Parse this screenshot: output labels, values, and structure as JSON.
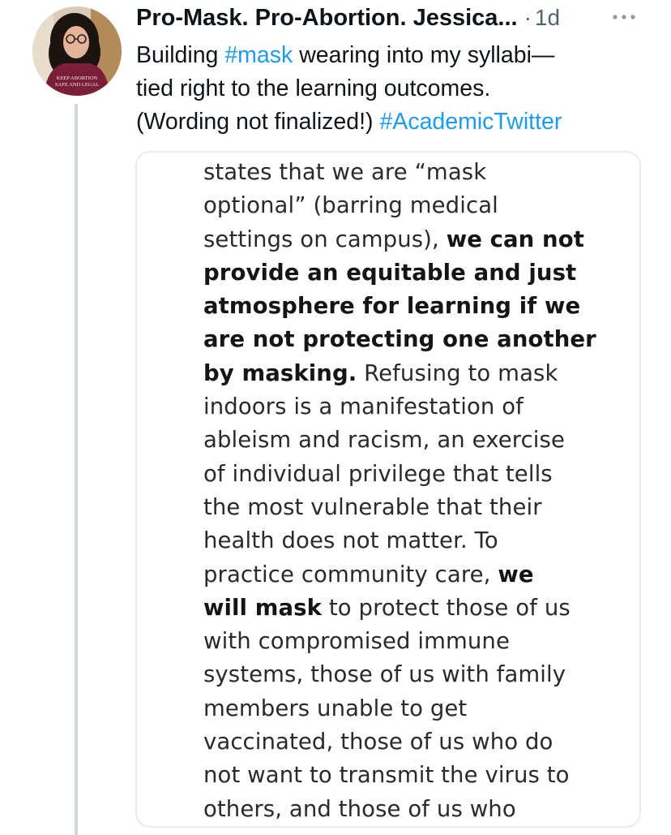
{
  "tweet": {
    "display_name": "Pro-Mask. Pro-Abortion. Jessica...",
    "dot": "·",
    "timestamp": "1d",
    "more_label": "···",
    "text": {
      "part1": "Building ",
      "hashtag1": "#mask",
      "part2": " wearing into my syllabi—",
      "part3": "tied right to the learning outcomes.",
      "part4": "(Wording not finalized!) ",
      "hashtag2": "#AcademicTwitter"
    },
    "avatar": {
      "shirt_text_line1": "KEEP ABORTION",
      "shirt_text_line2": "SAFE AND LEGAL"
    }
  },
  "media": {
    "lines": [
      {
        "t1": "states that we are “mask",
        "b": "",
        "t2": ""
      },
      {
        "t1": "optional” (barring medical",
        "b": "",
        "t2": ""
      },
      {
        "t1": "settings on campus), ",
        "b": "we can not",
        "t2": ""
      },
      {
        "t1": "",
        "b": "provide an equitable and just",
        "t2": ""
      },
      {
        "t1": "",
        "b": "atmosphere for learning if we",
        "t2": ""
      },
      {
        "t1": "",
        "b": "are not protecting one another",
        "t2": ""
      },
      {
        "t1": "",
        "b": "by masking.",
        "t2": " Refusing to mask"
      },
      {
        "t1": "indoors is a manifestation of",
        "b": "",
        "t2": ""
      },
      {
        "t1": "ableism and racism, an exercise",
        "b": "",
        "t2": ""
      },
      {
        "t1": "of individual privilege that tells",
        "b": "",
        "t2": ""
      },
      {
        "t1": "the most vulnerable that their",
        "b": "",
        "t2": ""
      },
      {
        "t1": "health does not matter. To",
        "b": "",
        "t2": ""
      },
      {
        "t1": "practice community care, ",
        "b": "we",
        "t2": ""
      },
      {
        "t1": "",
        "b": "will mask",
        "t2": " to protect those of us"
      },
      {
        "t1": "with compromised immune",
        "b": "",
        "t2": ""
      },
      {
        "t1": "systems, those of us with family",
        "b": "",
        "t2": ""
      },
      {
        "t1": "members unable to get",
        "b": "",
        "t2": ""
      },
      {
        "t1": "vaccinated, those of us who do",
        "b": "",
        "t2": ""
      },
      {
        "t1": "not want to transmit the virus to",
        "b": "",
        "t2": ""
      },
      {
        "t1": "others, and those of us who",
        "b": "",
        "t2": ""
      }
    ]
  },
  "colors": {
    "link": "#1d9bf0",
    "secondary_text": "#536471",
    "thread_line": "#cfd9de",
    "card_border": "#e6ecf0"
  }
}
